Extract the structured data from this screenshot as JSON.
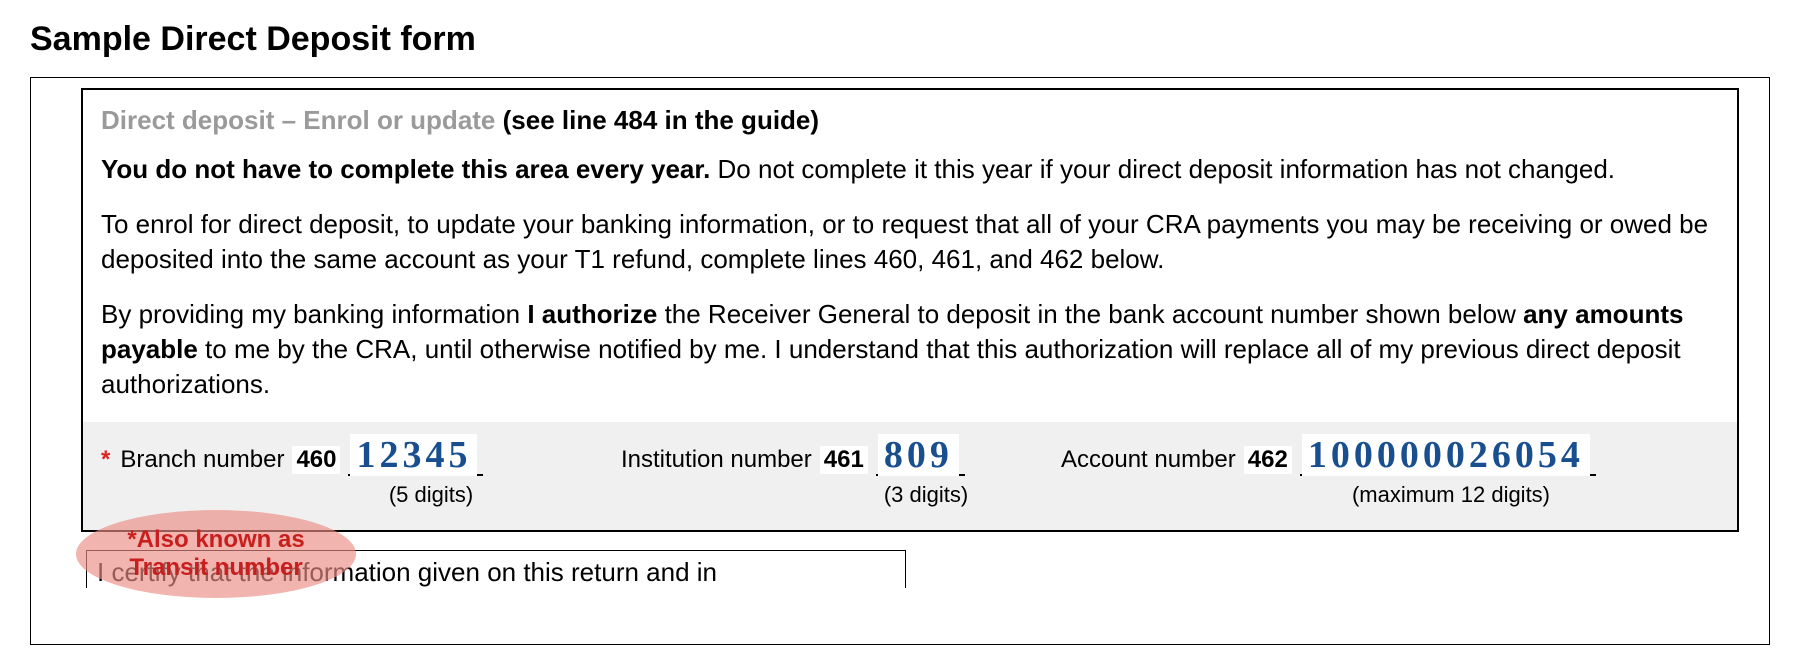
{
  "title": "Sample Direct Deposit form",
  "header": {
    "grey": "Direct deposit – Enrol or update",
    "black": " (see line 484 in the guide)"
  },
  "para1_bold": "You do not have to complete this area every year.",
  "para1_rest": " Do not complete it this year if your direct deposit information has not changed.",
  "para2": "To enrol for direct deposit, to update your banking information, or to request that all of your CRA payments you may be receiving or owed be deposited into the same account as your T1 refund, complete lines 460, 461, and 462 below.",
  "para3_a": "By providing my banking information ",
  "para3_b": "I authorize",
  "para3_c": " the Receiver General to deposit in the bank account number shown below ",
  "para3_d": "any amounts payable",
  "para3_e": " to me by the CRA, until otherwise notified by me.  I understand that this authorization will replace all of my previous direct deposit authorizations.",
  "fields": {
    "branch": {
      "star": "*",
      "label": "Branch number",
      "code": "460",
      "value": "12345",
      "hint": "(5 digits)"
    },
    "institution": {
      "label": "Institution number",
      "code": "461",
      "value": "809",
      "hint": "(3 digits)"
    },
    "account": {
      "label": "Account number",
      "code": "462",
      "value": "100000026054",
      "hint": "(maximum 12 digits)"
    }
  },
  "callout": "*Also known as Transit number",
  "certify": "I certify that the information given on this return and in"
}
